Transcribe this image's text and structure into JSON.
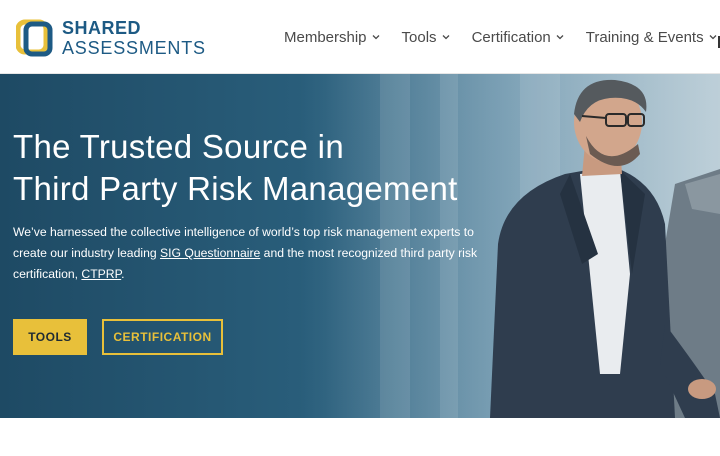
{
  "header": {
    "logo": {
      "line1": "SHARED",
      "line2": "ASSESSMENTS"
    },
    "nav": [
      {
        "label": "Membership"
      },
      {
        "label": "Tools"
      },
      {
        "label": "Certification"
      },
      {
        "label": "Training & Events"
      }
    ]
  },
  "hero": {
    "title_line1": "The Trusted Source in",
    "title_line2": "Third Party Risk Management",
    "desc_part1": "We’ve harnessed the collective intelligence of world’s top risk management experts to create our industry leading ",
    "desc_link1": "SIG Questionnaire",
    "desc_part2": " and the most recognized third party risk certification, ",
    "desc_link2": "CTPRP",
    "desc_part3": ".",
    "btn_tools": "TOOLS",
    "btn_certification": "CERTIFICATION"
  },
  "colors": {
    "brand_blue": "#1d5a84",
    "accent_yellow": "#e8c03a",
    "hero_dark": "#1e4a64"
  }
}
